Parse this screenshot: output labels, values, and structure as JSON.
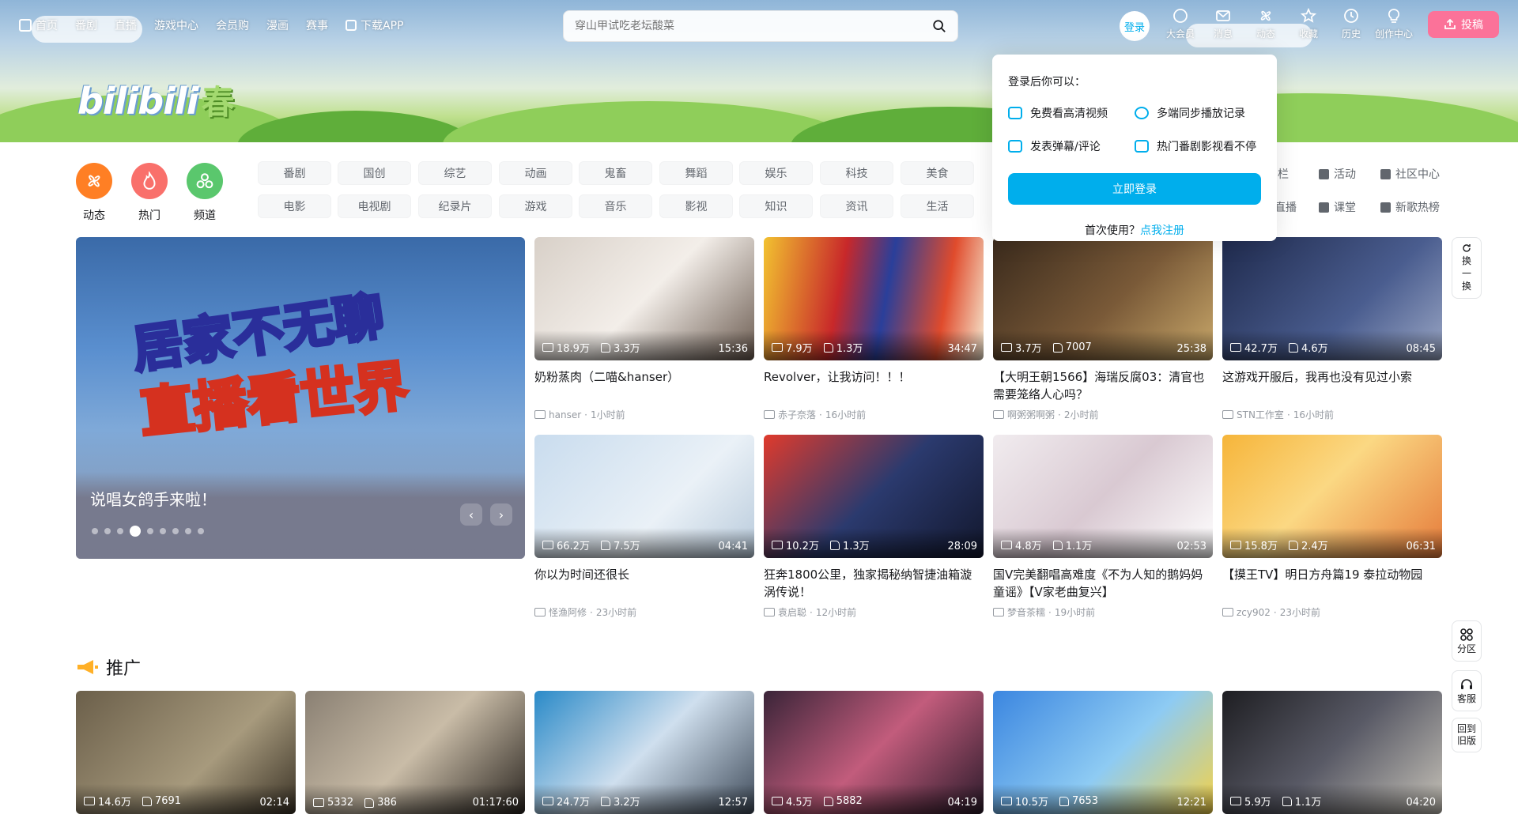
{
  "nav": {
    "left": [
      "首页",
      "番剧",
      "直播",
      "游戏中心",
      "会员购",
      "漫画",
      "赛事",
      "下载APP"
    ],
    "search_placeholder": "穿山甲试吃老坛酸菜",
    "login": "登录",
    "right": [
      {
        "label": "大会员",
        "icon": "vip-icon"
      },
      {
        "label": "消息",
        "icon": "message-icon"
      },
      {
        "label": "动态",
        "icon": "dynamic-icon"
      },
      {
        "label": "收藏",
        "icon": "star-icon"
      },
      {
        "label": "历史",
        "icon": "clock-icon"
      },
      {
        "label": "创作中心",
        "icon": "bulb-icon"
      }
    ],
    "upload": "投稿"
  },
  "logo": {
    "text": "bilibili",
    "season": "春"
  },
  "circles": [
    {
      "label": "动态",
      "color": "#ff7f24"
    },
    {
      "label": "热门",
      "color": "#f9706b"
    },
    {
      "label": "频道",
      "color": "#5ac76d"
    }
  ],
  "chips_row1": [
    "番剧",
    "国创",
    "综艺",
    "动画",
    "鬼畜",
    "舞蹈",
    "娱乐",
    "科技",
    "美食"
  ],
  "chips_row2": [
    "电影",
    "电视剧",
    "纪录片",
    "游戏",
    "音乐",
    "影视",
    "知识",
    "资讯",
    "生活"
  ],
  "ch_right_row1": [
    "专栏",
    "活动",
    "社区中心"
  ],
  "ch_right_row2": [
    "直播",
    "课堂",
    "新歌热榜"
  ],
  "hero": {
    "line1": "居家不无聊",
    "line2": "直播看世界",
    "caption": "说唱女鸽手来啦！"
  },
  "videos": [
    {
      "title": "奶粉蒸肉（二喵&hanser）",
      "views": "18.9万",
      "likes": "3.3万",
      "dur": "15:36",
      "author": "hanser",
      "time": "1小时前",
      "bg": "linear-gradient(135deg,#d8d0c8,#f3eee9 50%,#6b5b50)"
    },
    {
      "title": "Revolver，让我访问！！！",
      "views": "7.9万",
      "likes": "1.3万",
      "dur": "34:47",
      "author": "赤子奈落",
      "time": "16小时前",
      "bg": "linear-gradient(100deg,#f2c230 0%,#c8282a 35%,#2a3f9a 55%,#e04b2c 80%,#f5e8d0 100%)"
    },
    {
      "title": "【大明王朝1566】海瑞反腐03：清官也需要笼络人心吗？",
      "views": "3.7万",
      "likes": "7007",
      "dur": "25:38",
      "author": "啊粥粥啊粥",
      "time": "2小时前",
      "bg": "linear-gradient(135deg,#3a2a1c,#7a5a38 55%,#c9a86a)"
    },
    {
      "title": "这游戏开服后，我再也没有见过小索",
      "views": "42.7万",
      "likes": "4.6万",
      "dur": "08:45",
      "author": "STN工作室",
      "time": "16小时前",
      "bg": "linear-gradient(135deg,#1f2a4d,#4a5d8f 60%,#9aa6c4)"
    },
    {
      "title": "你以为时间还很长",
      "views": "66.2万",
      "likes": "7.5万",
      "dur": "04:41",
      "author": "怪渔阿修",
      "time": "23小时前",
      "bg": "linear-gradient(135deg,#c9dcee,#eaf1f7 60%,#b8cadb)"
    },
    {
      "title": "狂奔1800公里，独家揭秘纳智捷油箱漩涡传说！",
      "views": "10.2万",
      "likes": "1.3万",
      "dur": "28:09",
      "author": "袁启聪",
      "time": "12小时前",
      "bg": "linear-gradient(135deg,#e03a2c,#2b3a6e 50%,#12172d)"
    },
    {
      "title": "国V完美翻唱高难度《不为人知的鹅妈妈童谣》【V家老曲复兴】",
      "views": "4.8万",
      "likes": "1.1万",
      "dur": "02:53",
      "author": "梦音茶糯",
      "time": "19小时前",
      "bg": "linear-gradient(135deg,#f1ecef,#d9c9d2 50%,#ffffff)"
    },
    {
      "title": "【摸王TV】明日方舟篇19 泰拉动物园",
      "views": "15.8万",
      "likes": "2.4万",
      "dur": "06:31",
      "author": "zcy902",
      "time": "23小时前",
      "bg": "linear-gradient(135deg,#f6b53a,#fbd883 45%,#e57a3a)"
    }
  ],
  "promo_title": "推广",
  "promo": [
    {
      "views": "14.6万",
      "likes": "7691",
      "dur": "02:14",
      "bg": "linear-gradient(135deg,#6b5f4a,#a79a7d 60%,#3b3326)"
    },
    {
      "views": "5332",
      "likes": "386",
      "dur": "01:17:60",
      "bg": "linear-gradient(135deg,#8a8073,#c9bca7 50%,#2a2520)"
    },
    {
      "views": "24.7万",
      "likes": "3.2万",
      "dur": "12:57",
      "bg": "linear-gradient(135deg,#2a8ac8,#cfdfee 50%,#3f4b5a)"
    },
    {
      "views": "4.5万",
      "likes": "5882",
      "dur": "04:19",
      "bg": "linear-gradient(135deg,#3a2438,#c25c7c 50%,#2a1a2a)"
    },
    {
      "views": "10.5万",
      "likes": "7653",
      "dur": "12:21",
      "bg": "linear-gradient(135deg,#3b86e0,#8ecbf3 55%,#f5d246)"
    },
    {
      "views": "5.9万",
      "likes": "1.1万",
      "dur": "04:20",
      "bg": "linear-gradient(135deg,#1e1e22,#595a66 50%,#c6c2b8)"
    }
  ],
  "side": {
    "refresh": "换一换",
    "zone": "分区",
    "service": "客服",
    "old": "回到旧版"
  },
  "popup": {
    "heading": "登录后你可以：",
    "items": [
      "免费看高清视频",
      "多端同步播放记录",
      "发表弹幕/评论",
      "热门番剧影视看不停"
    ],
    "button": "立即登录",
    "first": "首次使用？",
    "register": "点我注册"
  }
}
